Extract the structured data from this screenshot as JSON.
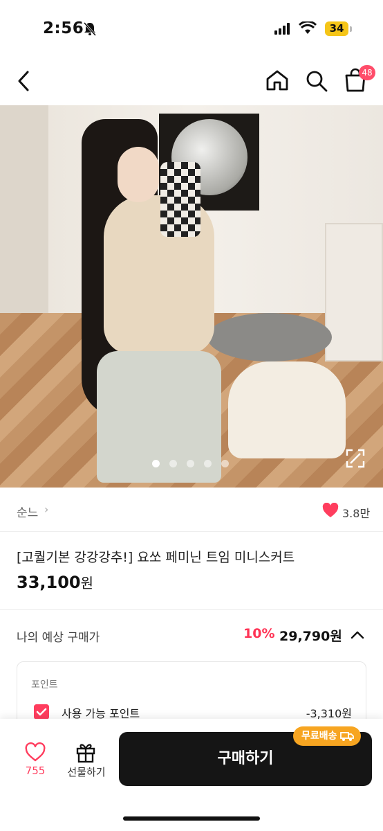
{
  "status_bar": {
    "time": "2:56",
    "battery": "34"
  },
  "nav": {
    "cart_count": "48"
  },
  "product": {
    "brand": "순느",
    "likes": "3.8만",
    "title": "[고퀄기본 강강강추!] 요쏘 페미닌 트임 미니스커트",
    "price": "33,100",
    "price_unit": "원",
    "image_index": 1,
    "image_count": 5
  },
  "expected_price": {
    "label": "나의 예상 구매가",
    "discount": "10%",
    "value": "29,790원"
  },
  "points": {
    "title": "포인트",
    "item_label": "사용 가능 포인트",
    "item_value": "-3,310원",
    "checked": true
  },
  "bottom_bar": {
    "wish_count": "755",
    "gift_label": "선물하기",
    "buy_label": "구매하기",
    "free_shipping_label": "무료배송"
  },
  "colors": {
    "accent": "#ff3d5e",
    "badge": "#f7a521",
    "buy_button": "#151515"
  }
}
